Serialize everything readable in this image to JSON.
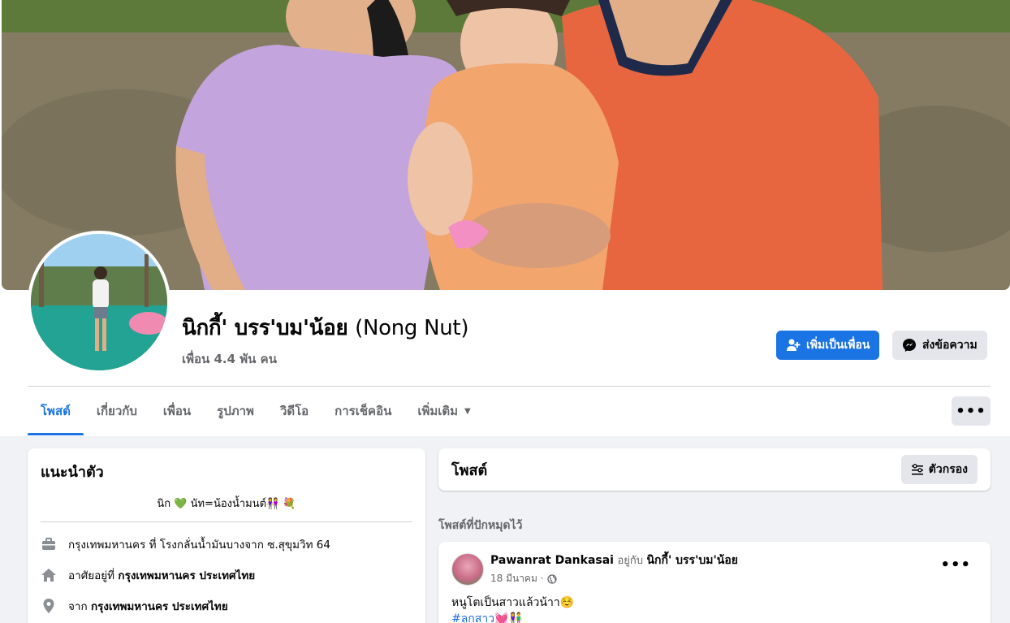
{
  "profile": {
    "name": "นิกกี้' บรร'บม'น้อย",
    "alt_name": "(Nong Nut)",
    "friends": "เพื่อน 4.4 พัน คน"
  },
  "actions": {
    "add_friend": "เพิ่มเป็นเพื่อน",
    "message": "ส่งข้อความ"
  },
  "tabs": [
    {
      "label": "โพสต์"
    },
    {
      "label": "เกี่ยวกับ"
    },
    {
      "label": "เพื่อน"
    },
    {
      "label": "รูปภาพ"
    },
    {
      "label": "วิดีโอ"
    },
    {
      "label": "การเช็คอิน"
    },
    {
      "label": "เพิ่มเติม"
    }
  ],
  "more_button": "•••",
  "intro": {
    "title": "แนะนำตัว",
    "bio": "นิก 💚 นัท=น้องน้ำมนต์👭 💐",
    "work": "กรุงเทพมหานคร ที่ โรงกลั่นน้ำมันบางจาก ซ.สุขุมวิท 64",
    "lives_prefix": "อาศัยอยู่ที่",
    "lives_place": "กรุงเทพมหานคร ประเทศไทย",
    "from_prefix": "จาก",
    "from_place": "กรุงเทพมหานคร ประเทศไทย"
  },
  "posts": {
    "title": "โพสต์",
    "filter": "ตัวกรอง",
    "pinned_label": "โพสต์ที่ปักหมุดไว้"
  },
  "post": {
    "author": "Pawanrat Dankasai",
    "with_text": "อยู่กับ",
    "tagged": "นิกกี้' บรร'บม'น้อย",
    "date": "18 มีนาคม ·",
    "text": "หนูโตเป็นสาวแล้วน้าา☺️",
    "hashtag": "#ลูกสาว💓👫",
    "dots": "•••"
  },
  "colors": {
    "primary": "#1b74e4",
    "background": "#f0f2f5",
    "secondary_button": "#e4e6eb",
    "muted_text": "#65676b"
  }
}
